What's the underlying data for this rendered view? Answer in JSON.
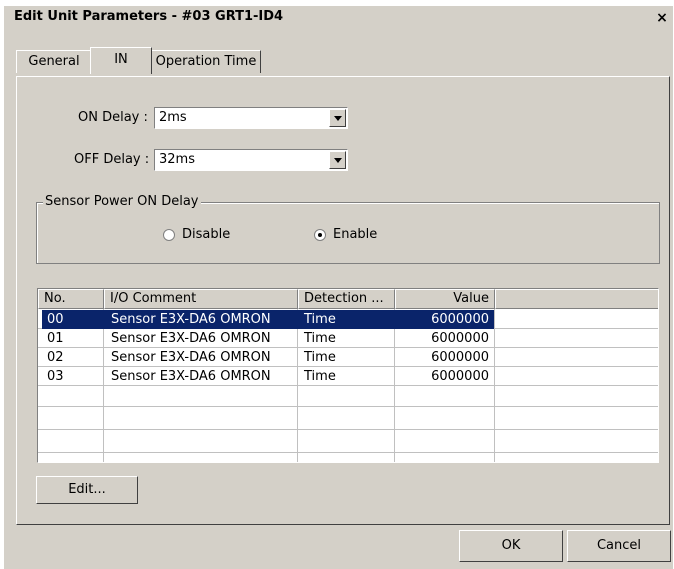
{
  "window": {
    "title": "Edit Unit Parameters - #03 GRT1-ID4",
    "close_glyph": "×"
  },
  "tabs": [
    {
      "label": "General"
    },
    {
      "label": "IN"
    },
    {
      "label": "Operation Time"
    }
  ],
  "on_delay": {
    "label": "ON Delay :",
    "value": "2ms"
  },
  "off_delay": {
    "label": "OFF Delay :",
    "value": "32ms"
  },
  "sensor_power": {
    "group_label": "Sensor Power ON Delay",
    "disable_label": "Disable",
    "enable_label": "Enable",
    "selected": "Enable"
  },
  "table": {
    "columns": [
      "No.",
      "I/O Comment",
      "Detection ...",
      "Value"
    ],
    "rows": [
      {
        "no": "00",
        "comment": "Sensor E3X-DA6 OMRON",
        "detection": "Time",
        "value": "6000000"
      },
      {
        "no": "01",
        "comment": "Sensor E3X-DA6 OMRON",
        "detection": "Time",
        "value": "6000000"
      },
      {
        "no": "02",
        "comment": "Sensor E3X-DA6 OMRON",
        "detection": "Time",
        "value": "6000000"
      },
      {
        "no": "03",
        "comment": "Sensor E3X-DA6 OMRON",
        "detection": "Time",
        "value": "6000000"
      }
    ],
    "selected_row": 0
  },
  "buttons": {
    "edit": "Edit...",
    "ok": "OK",
    "cancel": "Cancel"
  },
  "colors": {
    "dialog_bg": "#d4d0c8",
    "selection": "#0a246a"
  }
}
